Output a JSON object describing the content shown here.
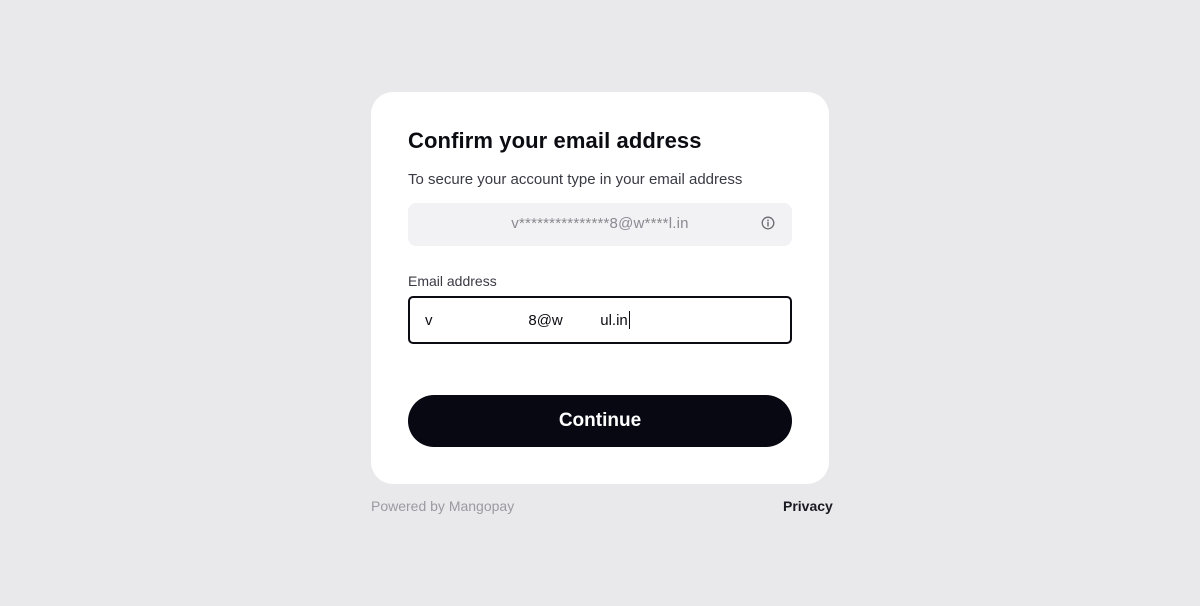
{
  "card": {
    "title": "Confirm your email address",
    "subtitle": "To secure your account type in your email address",
    "masked_email": "v***************8@w****l.in",
    "info_icon": "info-circle-icon",
    "email_label": "Email address",
    "email_value": "v                       8@w         ul.in",
    "continue_label": "Continue"
  },
  "footer": {
    "powered_by": "Powered by Mangopay",
    "privacy_label": "Privacy"
  },
  "colors": {
    "background": "#e9e8ea",
    "card": "#ffffff",
    "button": "#080812",
    "masked_box": "#f2f2f4"
  }
}
